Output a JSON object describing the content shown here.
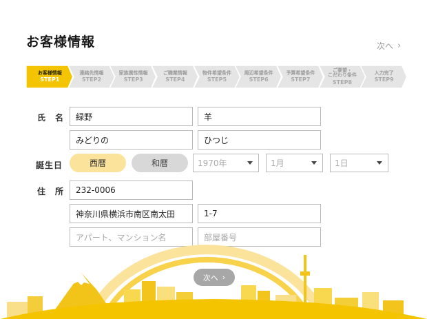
{
  "page": {
    "title": "お客様情報",
    "next_label": "次へ"
  },
  "steps": [
    {
      "name": "お客様情報",
      "step": "STEP1",
      "active": true
    },
    {
      "name": "連絡先情報",
      "step": "STEP2",
      "active": false
    },
    {
      "name": "家族属性情報",
      "step": "STEP3",
      "active": false
    },
    {
      "name": "ご職業情報",
      "step": "STEP4",
      "active": false
    },
    {
      "name": "物件希望条件",
      "step": "STEP5",
      "active": false
    },
    {
      "name": "周辺希望条件",
      "step": "STEP6",
      "active": false
    },
    {
      "name": "予算希望条件",
      "step": "STEP7",
      "active": false
    },
    {
      "name": "ご要望・\nこだわり条件",
      "step": "STEP8",
      "active": false
    },
    {
      "name": "入力完了",
      "step": "STEP9",
      "active": false
    }
  ],
  "form": {
    "name_label": "氏　名",
    "last_name": "緑野",
    "first_name": "羊",
    "last_name_kana": "みどりの",
    "first_name_kana": "ひつじ",
    "birth_label": "誕生日",
    "era_western": "西暦",
    "era_japanese": "和暦",
    "year": "1970年",
    "month": "1月",
    "day": "1日",
    "address_label": "住　所",
    "postal_code": "232-0006",
    "address1": "神奈川県横浜市南区南太田",
    "address2": "1-7",
    "building_placeholder": "アパート、マンション名",
    "room_placeholder": "部屋番号"
  },
  "colors": {
    "accent": "#f5c400",
    "accent_light": "#fbe39b",
    "step_inactive": "#e5e5e5"
  },
  "icons": {
    "next": "chevron-right-icon"
  }
}
